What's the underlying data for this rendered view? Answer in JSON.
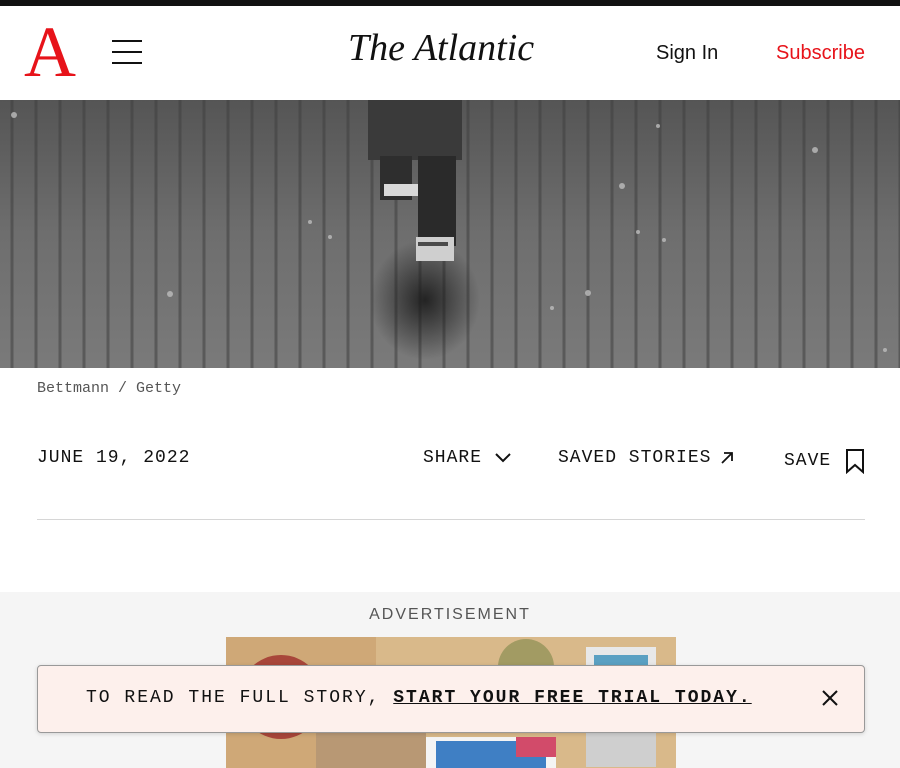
{
  "header": {
    "logo_letter": "A",
    "brand": "The Atlantic",
    "sign_in": "Sign In",
    "subscribe": "Subscribe",
    "brand_red": "#e7131a"
  },
  "hero": {
    "credit": "Bettmann / Getty"
  },
  "article_meta": {
    "date": "JUNE 19, 2022",
    "share_label": "SHARE",
    "saved_stories_label": "SAVED STORIES",
    "save_label": "SAVE"
  },
  "ad": {
    "label": "ADVERTISEMENT"
  },
  "paywall_banner": {
    "prefix": "TO READ THE FULL STORY, ",
    "link": "START YOUR FREE TRIAL TODAY.",
    "background": "#fdf0ec"
  },
  "icons": [
    "hamburger-menu-icon",
    "chevron-down-icon",
    "arrow-up-right-icon",
    "bookmark-icon",
    "close-icon"
  ]
}
